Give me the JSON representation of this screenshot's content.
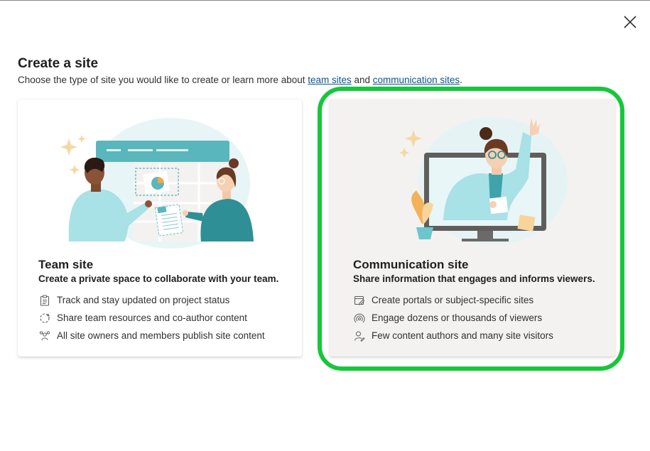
{
  "dialog": {
    "title": "Create a site",
    "subtitle_prefix": "Choose the type of site you would like to create or learn more about ",
    "link_team": "team sites",
    "subtitle_and": " and ",
    "link_comm": "communication sites",
    "subtitle_suffix": ".",
    "close_icon": "close-icon"
  },
  "cards": {
    "team": {
      "title": "Team site",
      "description": "Create a private space to collaborate with your team.",
      "features": [
        {
          "icon": "clipboard-icon",
          "text": "Track and stay updated on project status"
        },
        {
          "icon": "sync-icon",
          "text": "Share team resources and co-author content"
        },
        {
          "icon": "people-network-icon",
          "text": "All site owners and members publish site content"
        }
      ]
    },
    "communication": {
      "title": "Communication site",
      "description": "Share information that engages and informs viewers.",
      "features": [
        {
          "icon": "edit-page-icon",
          "text": "Create portals or subject-specific sites"
        },
        {
          "icon": "broadcast-icon",
          "text": "Engage dozens or thousands of viewers"
        },
        {
          "icon": "person-edit-icon",
          "text": "Few content authors and many site visitors"
        }
      ]
    }
  },
  "colors": {
    "highlight": "#16c73a",
    "link": "#0f548c",
    "teal_accent": "#40a4ab"
  }
}
